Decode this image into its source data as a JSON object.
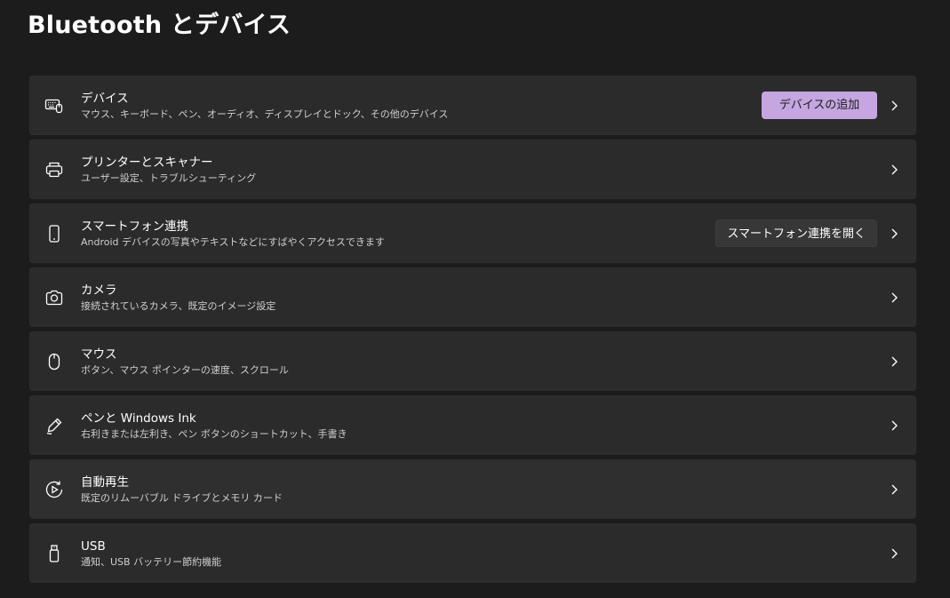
{
  "page": {
    "title": "Bluetooth とデバイス"
  },
  "colors": {
    "background": "#1c1c1c",
    "card": "#2b2b2b",
    "accent": "#c5a6e0",
    "secondary_button": "#373737"
  },
  "items": [
    {
      "icon": "keyboard-mouse-icon",
      "title": "デバイス",
      "description": "マウス、キーボード、ペン、オーディオ、ディスプレイとドック、その他のデバイス",
      "button": "デバイスの追加"
    },
    {
      "icon": "printer-icon",
      "title": "プリンターとスキャナー",
      "description": "ユーザー設定、トラブルシューティング"
    },
    {
      "icon": "phone-icon",
      "title": "スマートフォン連携",
      "description": "Android デバイスの写真やテキストなどにすばやくアクセスできます",
      "button": "スマートフォン連携を開く"
    },
    {
      "icon": "camera-icon",
      "title": "カメラ",
      "description": "接続されているカメラ、既定のイメージ設定"
    },
    {
      "icon": "mouse-icon",
      "title": "マウス",
      "description": "ボタン、マウス ポインターの速度、スクロール"
    },
    {
      "icon": "pen-icon",
      "title": "ペンと Windows Ink",
      "description": "右利きまたは左利き、ペン ボタンのショートカット、手書き"
    },
    {
      "icon": "autoplay-icon",
      "title": "自動再生",
      "description": "既定のリムーバブル ドライブとメモリ カード"
    },
    {
      "icon": "usb-icon",
      "title": "USB",
      "description": "通知、USB バッテリー節約機能"
    }
  ]
}
